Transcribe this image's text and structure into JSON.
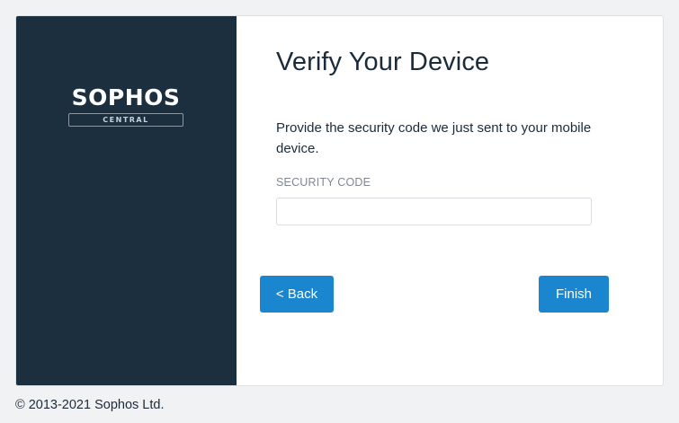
{
  "brand": {
    "logo_word": "SOPHOS",
    "logo_sub": "CENTRAL"
  },
  "form": {
    "title": "Verify Your Device",
    "instructions": "Provide the security code we just sent to your mobile device.",
    "security_code_label": "SECURITY CODE",
    "security_code_value": "",
    "security_code_placeholder": ""
  },
  "buttons": {
    "back_label": "< Back",
    "finish_label": "Finish"
  },
  "footer": {
    "copyright": "© 2013-2021 Sophos Ltd."
  },
  "colors": {
    "brand_panel": "#1c2f3f",
    "primary_button": "#1a86cf",
    "page_background": "#f1f2f4"
  }
}
